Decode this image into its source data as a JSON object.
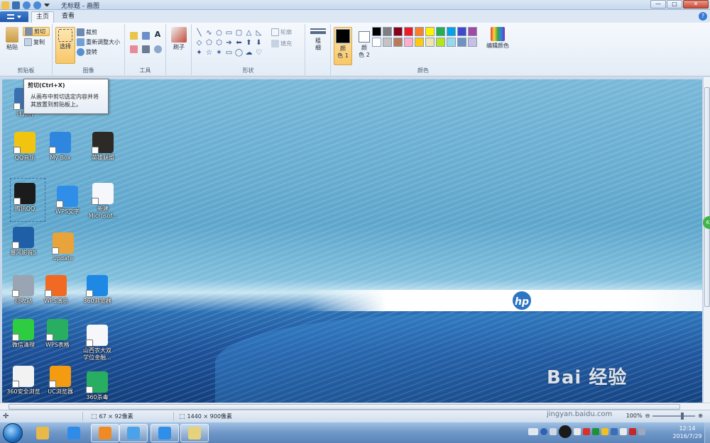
{
  "window": {
    "title": "无标题 - 画图",
    "controls": [
      "—",
      "□",
      "✕"
    ]
  },
  "tabs": {
    "home": "主页",
    "view": "查看"
  },
  "ribbon": {
    "clipboard": {
      "label": "剪贴板",
      "paste": "粘贴",
      "cut": "剪切",
      "copy": "复制"
    },
    "image": {
      "label": "图像",
      "select": "选择",
      "crop": "裁剪",
      "resize": "重新调整大小",
      "rotate": "旋转"
    },
    "tools": {
      "label": "工具"
    },
    "brushes": {
      "label": "刷子"
    },
    "shapes": {
      "label": "形状",
      "outline": "轮廓",
      "fill": "填充",
      "glyphs": [
        "╲",
        "∿",
        "○",
        "▭",
        "▢",
        "△",
        "◺",
        "◇",
        "⬠",
        "⬡",
        "➔",
        "⬅",
        "⬆",
        "⬇",
        "✦",
        "☆",
        "✶",
        "▭",
        "◯",
        "☁",
        "♡"
      ]
    },
    "size": {
      "label_line1": "粗",
      "label_line2": "细"
    },
    "colors": {
      "label": "颜色",
      "color1_line1": "颜",
      "color1_line2": "色 1",
      "color2_line1": "颜",
      "color2_line2": "色 2",
      "edit": "编辑颜色",
      "color1": "#000000",
      "color2": "#ffffff",
      "palette": [
        "#000000",
        "#7f7f7f",
        "#880015",
        "#ed1c24",
        "#ff7f27",
        "#fff200",
        "#22b14c",
        "#00a2e8",
        "#3f48cc",
        "#a349a4",
        "#ffffff",
        "#c3c3c3",
        "#b97a57",
        "#ffaec9",
        "#ffc90e",
        "#efe4b0",
        "#b5e61d",
        "#99d9ea",
        "#7092be",
        "#c8bfe7"
      ]
    }
  },
  "tooltip": {
    "title": "剪切(Ctrl+X)",
    "line1": "从画布中剪切选定内容并将",
    "line2": "其放置到剪贴板上。"
  },
  "desktop": {
    "icons": [
      {
        "label": "计算机",
        "color": "#3a6fb0"
      },
      {
        "label": "QQ音乐",
        "color": "#f1c40f"
      },
      {
        "label": "My Box",
        "color": "#2e86de"
      },
      {
        "label": "英雄联盟",
        "color": "#2d2a26"
      },
      {
        "label": "腾讯QQ",
        "color": "#1b1b1b"
      },
      {
        "label": "WPS文字",
        "color": "#2f8fe8"
      },
      {
        "label": "新建",
        "label2": "Microsof...",
        "color": "#f5f7fa"
      },
      {
        "label": "暴风影音5",
        "color": "#1f5fa8"
      },
      {
        "label": "update",
        "color": "#e8a33a"
      },
      {
        "label": "回收站",
        "color": "#9aa5b4"
      },
      {
        "label": "WPS演示",
        "color": "#f06a24"
      },
      {
        "label": "360浏览器",
        "color": "#1e88e5"
      },
      {
        "label": "微信清理",
        "color": "#2ecc40"
      },
      {
        "label": "WPS表格",
        "color": "#27ae60"
      },
      {
        "label": "山西农大双",
        "label2": "学位金融...",
        "color": "#f5f7fa"
      },
      {
        "label": "360安全浏览",
        "color": "#f2f2f2"
      },
      {
        "label": "UC浏览器",
        "color": "#f39c12"
      },
      {
        "label": "360杀毒",
        "color": "#27ae60"
      }
    ],
    "brand": "hp"
  },
  "status": {
    "selection_size": "67 × 92像素",
    "canvas_size": "1440 × 900像素",
    "zoom": "100%"
  },
  "taskbar": {
    "time": "12:14",
    "date": "2016/7/29",
    "apps": [
      {
        "name": "explorer",
        "color": "#e8b94a"
      },
      {
        "name": "ie",
        "color": "#2f8be8"
      },
      {
        "name": "uc",
        "color": "#f08a24"
      },
      {
        "name": "qq-browser",
        "color": "#4aa3e8"
      },
      {
        "name": "wps",
        "color": "#2f8fe8"
      },
      {
        "name": "paint",
        "color": "#e6d27a"
      }
    ]
  },
  "watermark": {
    "text": "Bai  经验",
    "sub": "jingyan.baidu.com"
  }
}
